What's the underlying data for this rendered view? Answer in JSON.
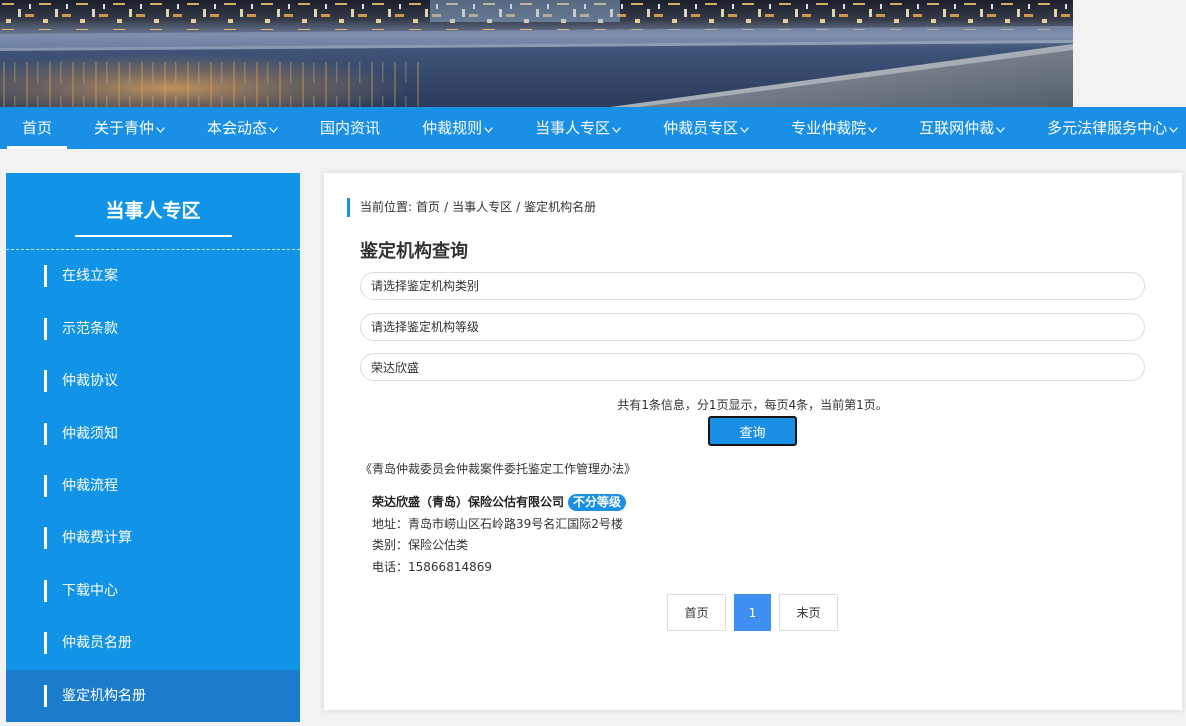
{
  "colors": {
    "nav_background": "#1a8fe6",
    "sidebar_background": "#1194e7",
    "sidebar_active": "#1b7ccb",
    "pagination_active": "#3d8ff1",
    "badge_background": "#1a8fe6",
    "page_background": "#f2f2f2"
  },
  "nav": {
    "dropdown_icon": "chevron-down-icon",
    "items": [
      {
        "label": "首页",
        "active": true,
        "dropdown": false
      },
      {
        "label": "关于青仲",
        "dropdown": true
      },
      {
        "label": "本会动态",
        "dropdown": true
      },
      {
        "label": "国内资讯",
        "dropdown": false
      },
      {
        "label": "仲裁规则",
        "dropdown": true
      },
      {
        "label": "当事人专区",
        "dropdown": true
      },
      {
        "label": "仲裁员专区",
        "dropdown": true
      },
      {
        "label": "专业仲裁院",
        "dropdown": true
      },
      {
        "label": "互联网仲裁",
        "dropdown": true
      },
      {
        "label": "多元法律服务中心",
        "dropdown": true
      }
    ]
  },
  "sidebar": {
    "title": "当事人专区",
    "items": [
      {
        "label": "在线立案"
      },
      {
        "label": "示范条款"
      },
      {
        "label": "仲裁协议"
      },
      {
        "label": "仲裁须知"
      },
      {
        "label": "仲裁流程"
      },
      {
        "label": "仲裁费计算"
      },
      {
        "label": "下载中心"
      },
      {
        "label": "仲裁员名册"
      },
      {
        "label": "鉴定机构名册",
        "active": true
      }
    ]
  },
  "main": {
    "breadcrumb": {
      "prefix": "当前位置:",
      "separator": "/",
      "items": [
        "首页",
        "当事人专区",
        "鉴定机构名册"
      ]
    },
    "heading": "鉴定机构查询",
    "form": {
      "category": {
        "selected": "请选择鉴定机构类别"
      },
      "level": {
        "selected": "请选择鉴定机构等级"
      },
      "keyword": {
        "value": "荣达欣盛"
      },
      "summary": "共有1条信息，分1页显示，每页4条，当前第1页。",
      "submit_label": "查询"
    },
    "regulation_link": "《青岛仲裁委员会仲裁案件委托鉴定工作管理办法》",
    "results": [
      {
        "name": "荣达欣盛（青岛）保险公估有限公司",
        "grade": "不分等级",
        "address": {
          "label": "地址：",
          "value": "青岛市崂山区石岭路39号名汇国际2号楼"
        },
        "category": {
          "label": "类别：",
          "value": "保险公估类"
        },
        "phone": {
          "label": "电话：",
          "value": "15866814869"
        }
      }
    ],
    "pagination": {
      "first_label": "首页",
      "pages": [
        {
          "number": "1",
          "current": true
        }
      ],
      "last_label": "末页"
    }
  }
}
